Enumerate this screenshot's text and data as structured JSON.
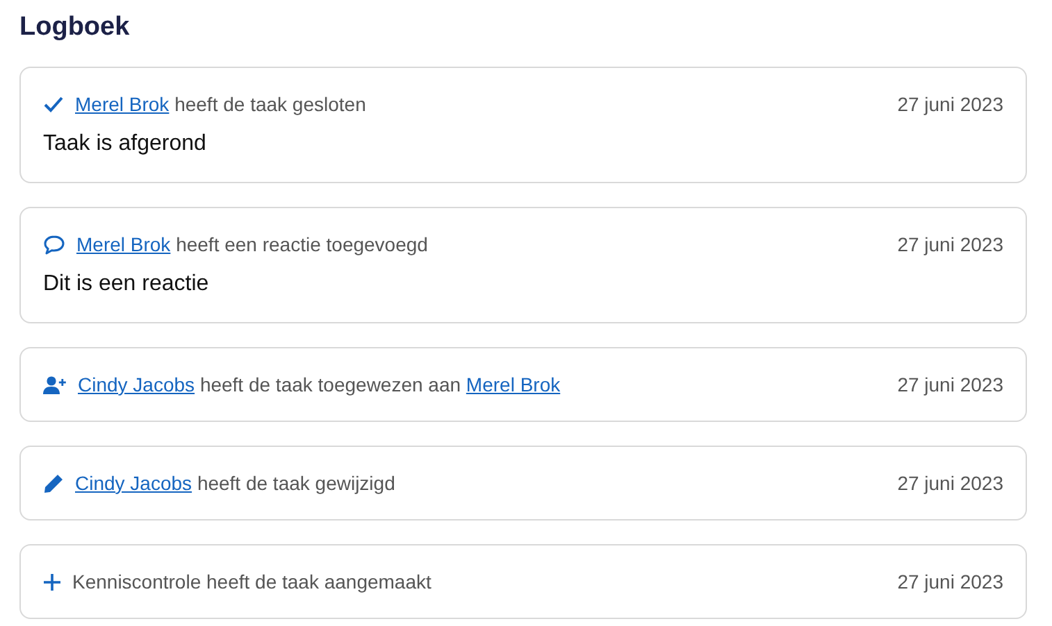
{
  "title": "Logboek",
  "entries": [
    {
      "kind": "closed",
      "parts": [
        {
          "kind": "link",
          "text": "Merel Brok"
        },
        {
          "kind": "text",
          "text": "heeft de taak gesloten"
        }
      ],
      "date": "27 juni 2023",
      "body": "Taak is afgerond"
    },
    {
      "kind": "comment",
      "parts": [
        {
          "kind": "link",
          "text": "Merel Brok"
        },
        {
          "kind": "text",
          "text": "heeft een reactie toegevoegd"
        }
      ],
      "date": "27 juni 2023",
      "body": "Dit is een reactie"
    },
    {
      "kind": "assigned",
      "parts": [
        {
          "kind": "link",
          "text": "Cindy Jacobs"
        },
        {
          "kind": "text",
          "text": "heeft de taak toegewezen aan"
        },
        {
          "kind": "link",
          "text": "Merel Brok"
        }
      ],
      "date": "27 juni 2023"
    },
    {
      "kind": "edited",
      "parts": [
        {
          "kind": "link",
          "text": "Cindy Jacobs"
        },
        {
          "kind": "text",
          "text": "heeft de taak gewijzigd"
        }
      ],
      "date": "27 juni 2023"
    },
    {
      "kind": "created",
      "parts": [
        {
          "kind": "text",
          "text": "Kenniscontrole heeft de taak aangemaakt"
        }
      ],
      "date": "27 juni 2023"
    }
  ]
}
